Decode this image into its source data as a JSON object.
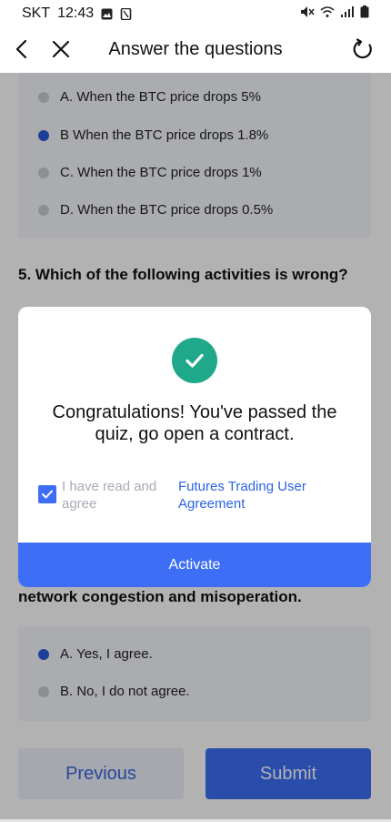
{
  "status": {
    "carrier": "SKT",
    "time": "12:43"
  },
  "nav": {
    "title": "Answer the questions"
  },
  "q4": {
    "options": [
      {
        "label": "A. When the BTC price drops 5%",
        "selected": false
      },
      {
        "label": "B When the BTC price drops 1.8%",
        "selected": true
      },
      {
        "label": "C. When the BTC price drops 1%",
        "selected": false
      },
      {
        "label": "D. When the BTC price drops 0.5%",
        "selected": false
      }
    ]
  },
  "q5": {
    "title": "5. Which of the following activities is wrong?",
    "partial_text": "network congestion and misoperation.",
    "options": [
      {
        "label": "A. Yes, I agree.",
        "selected": true
      },
      {
        "label": "B. No, I do not agree.",
        "selected": false
      }
    ]
  },
  "buttons": {
    "previous": "Previous",
    "submit": "Submit"
  },
  "modal": {
    "message": "Congratulations! You've passed the quiz, go open a contract.",
    "agree_text": "I have read and agree",
    "agree_link": "Futures Trading User Agreement",
    "action": "Activate"
  },
  "colors": {
    "accent": "#3d6ef5",
    "success": "#1fa98a"
  }
}
